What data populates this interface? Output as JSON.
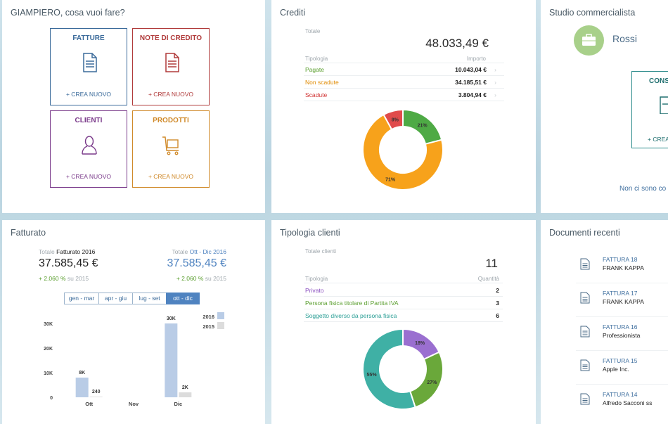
{
  "actions": {
    "title": "GIAMPIERO, cosa vuoi fare?",
    "tiles": [
      {
        "label": "FATTURE",
        "create": "+ CREA NUOVO",
        "color": "#3a6a9a"
      },
      {
        "label": "NOTE DI CREDITO",
        "create": "+ CREA NUOVO",
        "color": "#b03a3a"
      },
      {
        "label": "CLIENTI",
        "create": "+ CREA NUOVO",
        "color": "#7a3a8a"
      },
      {
        "label": "PRODOTTI",
        "create": "+ CREA NUOVO",
        "color": "#d08a2a"
      }
    ]
  },
  "crediti": {
    "title": "Crediti",
    "total_label": "Totale",
    "total_value": "48.033,49 €",
    "col_type": "Tipologia",
    "col_amount": "Importo",
    "rows": [
      {
        "label": "Pagate",
        "value": "10.043,04 €",
        "color": "#5a9e2e"
      },
      {
        "label": "Non scadute",
        "value": "34.185,51 €",
        "color": "#e08a00"
      },
      {
        "label": "Scadute",
        "value": "3.804,94 €",
        "color": "#d03030"
      }
    ]
  },
  "studio": {
    "title": "Studio commercialista",
    "name": "Rossi",
    "tile_label": "CONS",
    "tile_create": "+ CREA",
    "empty_text": "Non ci sono co"
  },
  "fatturato": {
    "title": "Fatturato",
    "left": {
      "label_prefix": "Totale",
      "label_strong": "Fatturato 2016",
      "value": "37.585,45 €",
      "delta": "+ 2.060 %",
      "delta_suffix": "su 2015"
    },
    "right": {
      "label_prefix": "Totale",
      "label_strong": "Ott - Dic 2016",
      "value": "37.585,45 €",
      "delta": "+ 2.060 %",
      "delta_suffix": "su 2015"
    },
    "periods": [
      "gen - mar",
      "apr - giu",
      "lug - set",
      "ott - dic"
    ]
  },
  "tipologia": {
    "title": "Tipologia clienti",
    "total_label": "Totale clienti",
    "total_value": "11",
    "col_type": "Tipologia",
    "col_qty": "Quantità",
    "rows": [
      {
        "label": "Privato",
        "value": "2",
        "color": "#8a4fc0"
      },
      {
        "label": "Persona fisica titolare di Partita IVA",
        "value": "3",
        "color": "#5a9e2e"
      },
      {
        "label": "Soggetto diverso da persona fisica",
        "value": "6",
        "color": "#2a9e95"
      }
    ]
  },
  "documenti": {
    "title": "Documenti recenti",
    "items": [
      {
        "title": "FATTURA 18",
        "client": "FRANK KAPPA"
      },
      {
        "title": "FATTURA 17",
        "client": "FRANK KAPPA"
      },
      {
        "title": "FATTURA 16",
        "client": "Professionista"
      },
      {
        "title": "FATTURA 15",
        "client": "Apple Inc."
      },
      {
        "title": "FATTURA 14",
        "client": "Alfredo Sacconi ss"
      }
    ]
  },
  "chart_data": [
    {
      "type": "pie",
      "donut": true,
      "labels": [
        "Pagate",
        "Non scadute",
        "Scadute"
      ],
      "values": [
        21,
        71,
        8
      ],
      "value_labels": [
        "21%",
        "71%",
        "8%"
      ],
      "colors": [
        "#4eaa45",
        "#f7a21b",
        "#e04b4b"
      ]
    },
    {
      "type": "bar",
      "categories": [
        "Ott",
        "Nov",
        "Dic"
      ],
      "series": [
        {
          "name": "2016",
          "values": [
            8000,
            0,
            30000
          ],
          "labels": [
            "8K",
            "",
            "30K"
          ],
          "color": "#b9cce6"
        },
        {
          "name": "2015",
          "values": [
            240,
            0,
            2000
          ],
          "labels": [
            "240",
            "",
            "2K"
          ],
          "color": "#dcdcdc"
        }
      ],
      "yticks": [
        "0",
        "10K",
        "20K",
        "30K"
      ],
      "ylim": [
        0,
        32000
      ],
      "legend": "top-right"
    },
    {
      "type": "pie",
      "donut": true,
      "labels": [
        "Privato",
        "Persona fisica titolare di Partita IVA",
        "Soggetto diverso da persona fisica"
      ],
      "values": [
        18,
        27,
        55
      ],
      "value_labels": [
        "18%",
        "27%",
        "55%"
      ],
      "colors": [
        "#9a6fd0",
        "#6aa83a",
        "#3fb0a5"
      ]
    }
  ]
}
